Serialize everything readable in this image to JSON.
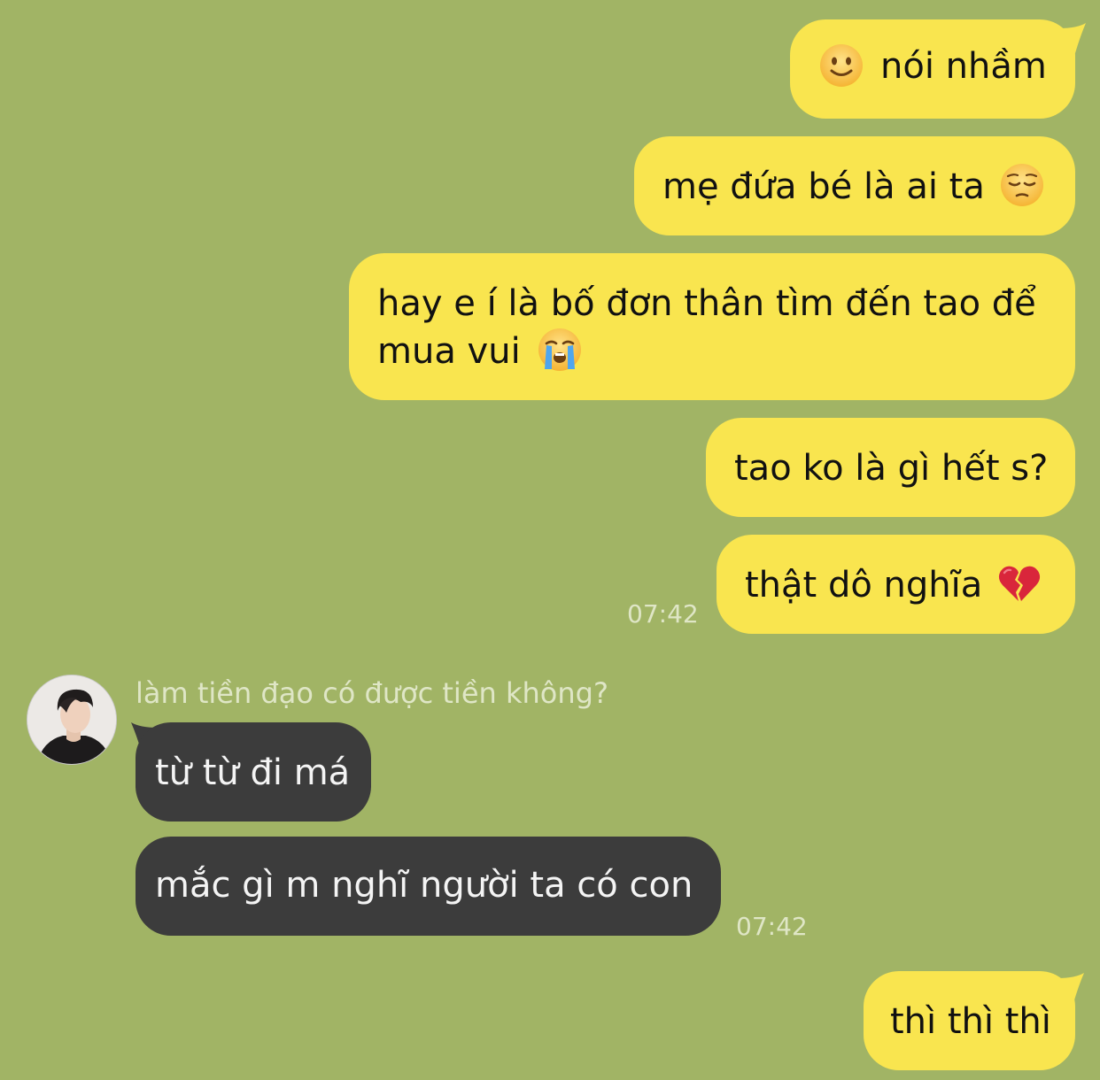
{
  "messages": [
    {
      "id": "m1",
      "text": "nói nhầm",
      "emoji": "slightly-smiling-face-icon",
      "emoji_position": "before"
    },
    {
      "id": "m2",
      "text": "mẹ đứa bé là ai ta",
      "emoji": "pensive-face-icon",
      "emoji_position": "after"
    },
    {
      "id": "m3",
      "line1": "hay e í là bố đơn thân tìm đến tao để",
      "line2": "mua vui",
      "emoji": "loudly-crying-face-icon",
      "emoji_position": "after"
    },
    {
      "id": "m4",
      "text": "tao ko là gì hết s?"
    },
    {
      "id": "m5",
      "text": "thật dô nghĩa",
      "emoji": "broken-heart-icon",
      "emoji_position": "after"
    },
    {
      "id": "m6",
      "text": "từ từ đi má"
    },
    {
      "id": "m7",
      "text": "mắc gì m nghĩ người ta có con"
    },
    {
      "id": "m8",
      "text": "thì thì thì"
    }
  ],
  "times": {
    "outgoing_group": "07:42",
    "incoming_group": "07:42"
  },
  "incoming": {
    "sender_name": "làm tiền đạo có được tiền không?"
  },
  "colors": {
    "background": "#a1b465",
    "outgoing_bubble": "#f9e54f",
    "incoming_bubble": "#3c3c3c",
    "timestamp": "#dfe6c6"
  }
}
